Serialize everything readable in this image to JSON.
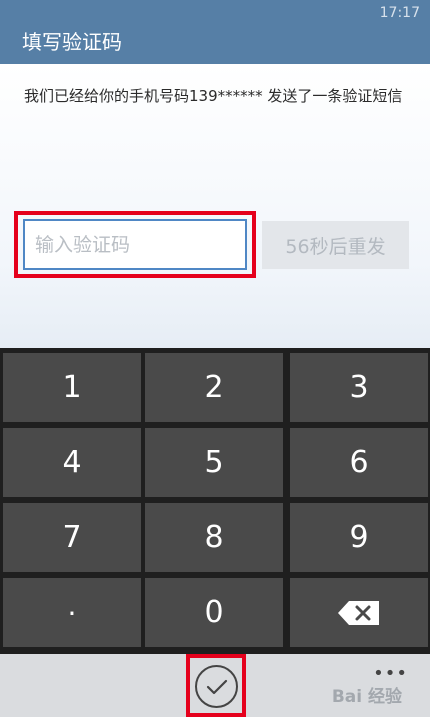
{
  "status_bar": {
    "time": "17:17"
  },
  "header": {
    "title": "填写验证码"
  },
  "message": "我们已经给你的手机号码139****** 发送了一条验证短信",
  "code_input": {
    "placeholder": "输入验证码",
    "value": ""
  },
  "resend_button": {
    "label": "56秒后重发"
  },
  "keypad": {
    "keys": [
      "1",
      "2",
      "3",
      "4",
      "5",
      "6",
      "7",
      "8",
      "9",
      ".",
      "0"
    ],
    "backspace_icon": "backspace-icon"
  },
  "app_bar": {
    "confirm_icon": "checkmark-icon",
    "more_label": "•••",
    "watermark": "Bai 经验"
  }
}
